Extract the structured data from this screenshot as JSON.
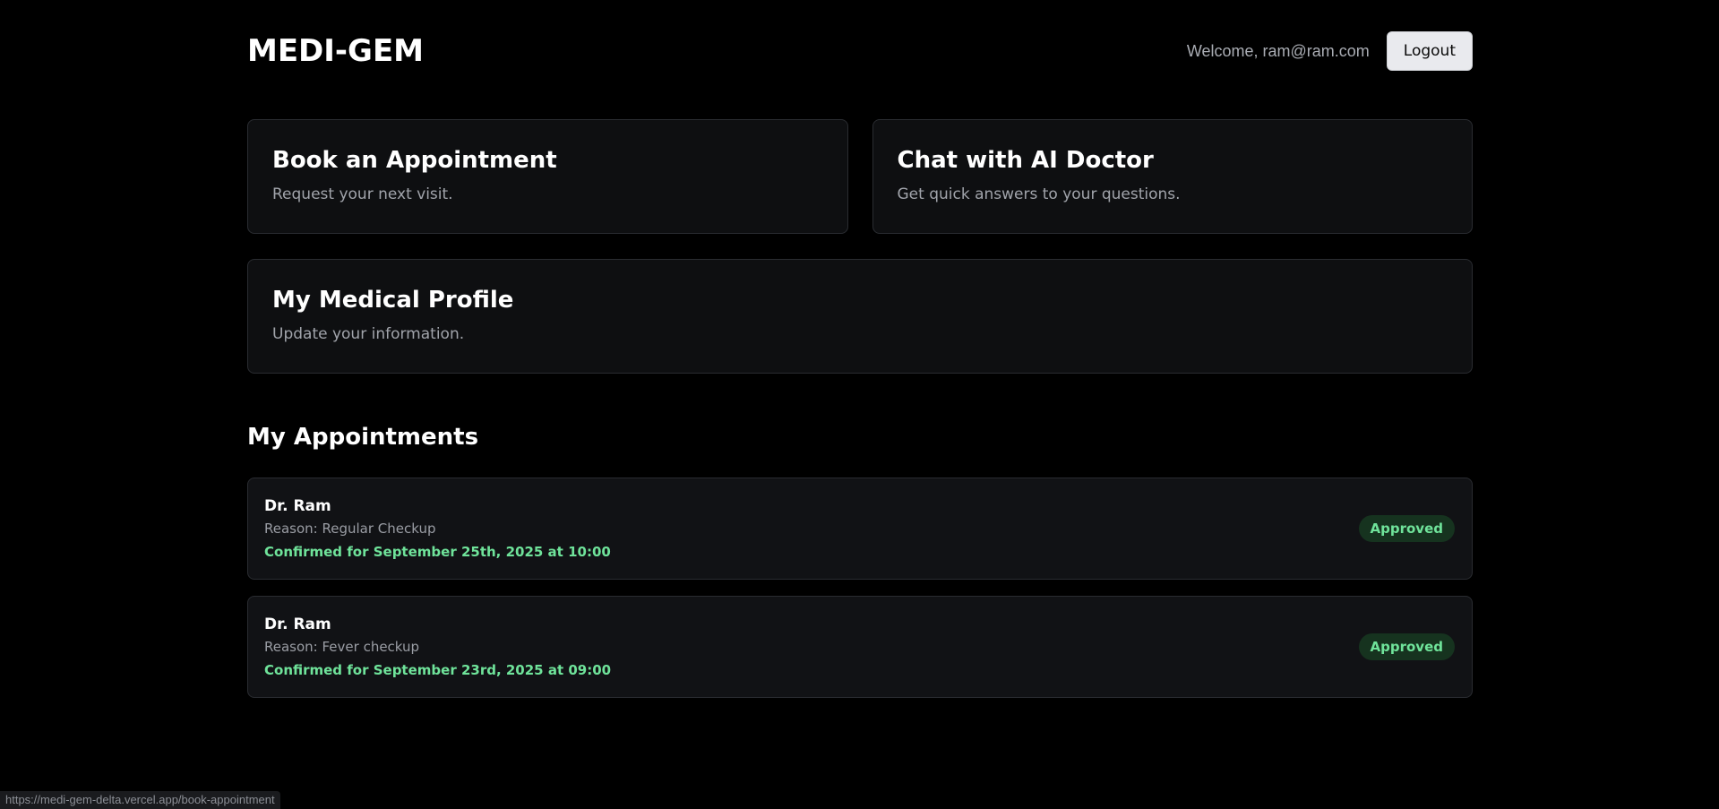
{
  "header": {
    "brand": "MEDI-GEM",
    "welcome": "Welcome, ram@ram.com",
    "logout_label": "Logout"
  },
  "cards": {
    "book": {
      "title": "Book an Appointment",
      "description": "Request your next visit."
    },
    "chat": {
      "title": "Chat with AI Doctor",
      "description": "Get quick answers to your questions."
    },
    "profile": {
      "title": "My Medical Profile",
      "description": "Update your information."
    }
  },
  "appointments": {
    "section_title": "My Appointments",
    "items": [
      {
        "doctor": "Dr. Ram",
        "reason": "Reason: Regular Checkup",
        "confirmation": "Confirmed for September 25th, 2025 at 10:00",
        "status": "Approved"
      },
      {
        "doctor": "Dr. Ram",
        "reason": "Reason: Fever checkup",
        "confirmation": "Confirmed for September 23rd, 2025 at 09:00",
        "status": "Approved"
      }
    ]
  },
  "status_bar": {
    "url": "https://medi-gem-delta.vercel.app/book-appointment"
  },
  "colors": {
    "background": "#000000",
    "card_bg": "#0e0f11",
    "accent_green": "#6fe39a",
    "badge_bg": "#16331f"
  }
}
